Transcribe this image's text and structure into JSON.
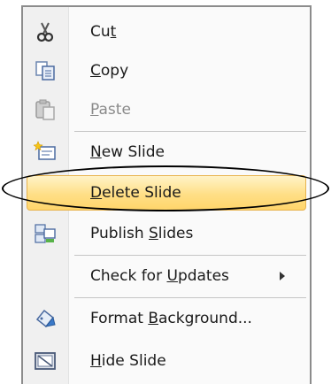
{
  "menu": {
    "items": [
      {
        "id": "cut",
        "pre": "Cu",
        "acc": "t",
        "post": "",
        "icon": "scissors-icon",
        "enabled": true
      },
      {
        "id": "copy",
        "pre": "",
        "acc": "C",
        "post": "opy",
        "icon": "copy-icon",
        "enabled": true
      },
      {
        "id": "paste",
        "pre": "",
        "acc": "P",
        "post": "aste",
        "icon": "paste-icon",
        "enabled": false
      },
      {
        "id": "new-slide",
        "pre": "",
        "acc": "N",
        "post": "ew Slide",
        "icon": "new-slide-icon",
        "enabled": true
      },
      {
        "id": "delete-slide",
        "pre": "",
        "acc": "D",
        "post": "elete Slide",
        "icon": "",
        "enabled": true,
        "highlighted": true
      },
      {
        "id": "publish-slides",
        "pre": "Publish ",
        "acc": "S",
        "post": "lides",
        "icon": "publish-slides-icon",
        "enabled": true
      },
      {
        "id": "check-for-updates",
        "pre": "Check for ",
        "acc": "U",
        "post": "pdates",
        "icon": "",
        "enabled": true,
        "submenu": true
      },
      {
        "id": "format-background",
        "pre": "Format ",
        "acc": "B",
        "post": "ackground...",
        "icon": "format-background-icon",
        "enabled": true
      },
      {
        "id": "hide-slide",
        "pre": "",
        "acc": "H",
        "post": "ide Slide",
        "icon": "hide-slide-icon",
        "enabled": true
      }
    ]
  },
  "colors": {
    "highlight_border": "#e8b34d",
    "highlight_fill": "#ffdf86",
    "annotation_ellipse": "#000000"
  }
}
